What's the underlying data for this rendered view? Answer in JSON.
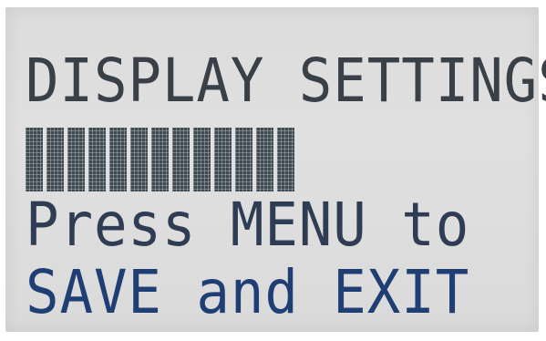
{
  "lcd": {
    "line1": "DISPLAY SETTINGS",
    "line3": "Press MENU to",
    "line4": "SAVE and EXIT"
  },
  "level_bar": {
    "filled_segments": 13,
    "fraction": 0.6
  },
  "colors": {
    "panel_background": "#dcdcdc",
    "pixel_dark": "#3a4048",
    "pixel_blue": "#1f3f74"
  }
}
